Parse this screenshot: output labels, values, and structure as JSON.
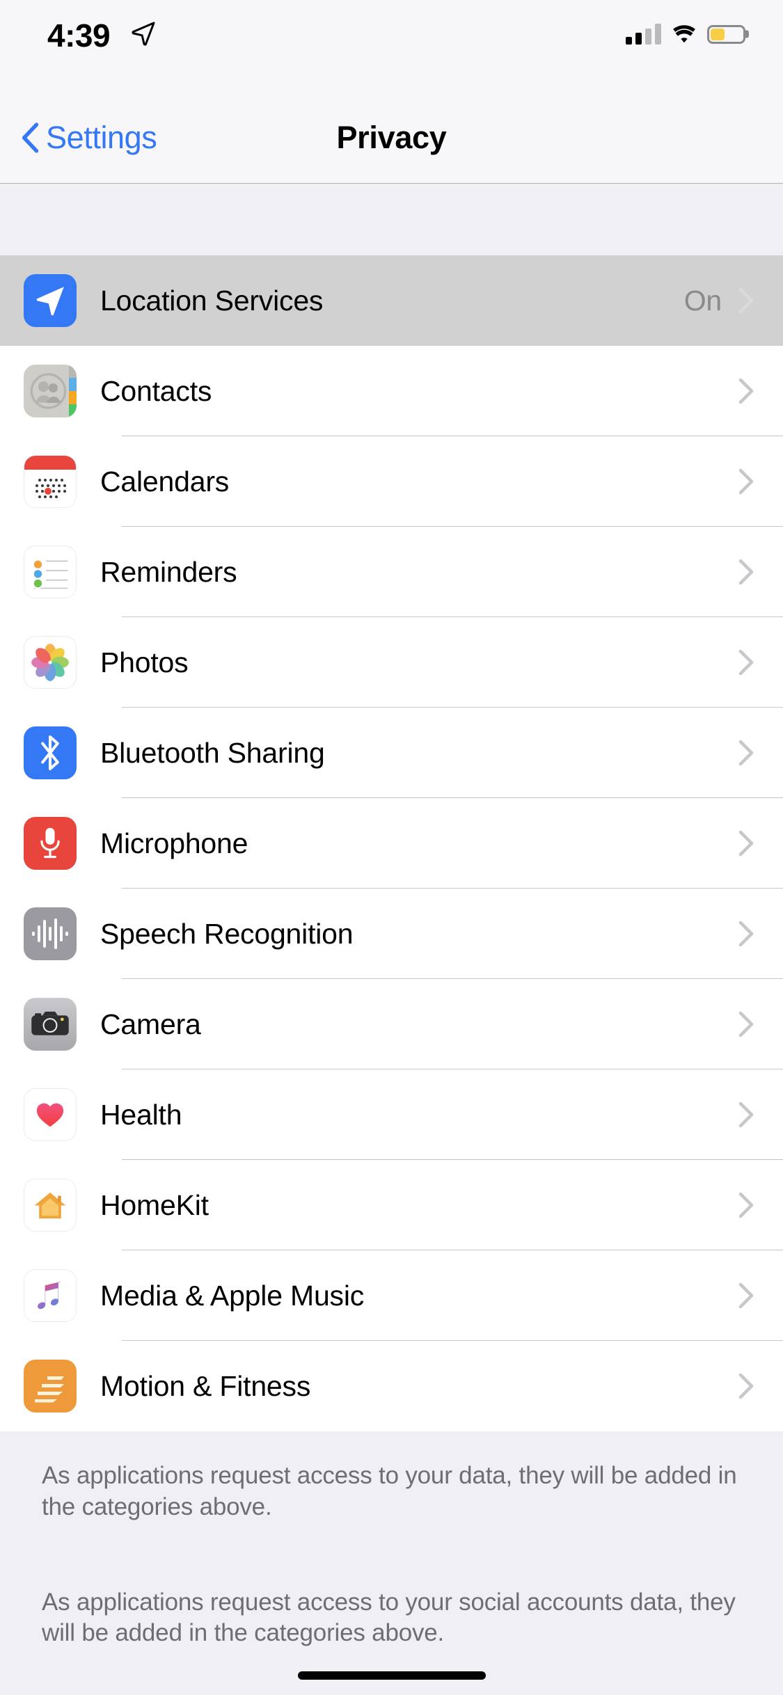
{
  "status_bar": {
    "time": "4:39",
    "location_icon": "location-arrow-icon",
    "cellular_icon": "cellular-signal-icon",
    "cellular_bars_filled": 2,
    "cellular_bars_total": 4,
    "wifi_icon": "wifi-icon",
    "battery_icon": "battery-icon",
    "battery_level_percent": 45,
    "battery_color": "#F7CE46"
  },
  "nav_bar": {
    "back_label": "Settings",
    "back_icon": "chevron-left-icon",
    "title": "Privacy",
    "tint_color": "#3478F6"
  },
  "list": {
    "rows": [
      {
        "label": "Location Services",
        "value": "On",
        "icon": "location-services-icon",
        "selected": true
      },
      {
        "label": "Contacts",
        "value": "",
        "icon": "contacts-icon",
        "selected": false
      },
      {
        "label": "Calendars",
        "value": "",
        "icon": "calendars-icon",
        "selected": false
      },
      {
        "label": "Reminders",
        "value": "",
        "icon": "reminders-icon",
        "selected": false
      },
      {
        "label": "Photos",
        "value": "",
        "icon": "photos-icon",
        "selected": false
      },
      {
        "label": "Bluetooth Sharing",
        "value": "",
        "icon": "bluetooth-icon",
        "selected": false
      },
      {
        "label": "Microphone",
        "value": "",
        "icon": "microphone-icon",
        "selected": false
      },
      {
        "label": "Speech Recognition",
        "value": "",
        "icon": "speech-recognition-icon",
        "selected": false
      },
      {
        "label": "Camera",
        "value": "",
        "icon": "camera-icon",
        "selected": false
      },
      {
        "label": "Health",
        "value": "",
        "icon": "health-icon",
        "selected": false
      },
      {
        "label": "HomeKit",
        "value": "",
        "icon": "homekit-icon",
        "selected": false
      },
      {
        "label": "Media & Apple Music",
        "value": "",
        "icon": "media-apple-music-icon",
        "selected": false
      },
      {
        "label": "Motion & Fitness",
        "value": "",
        "icon": "motion-fitness-icon",
        "selected": false
      }
    ],
    "chevron_icon": "chevron-right-icon",
    "selected_row_background": "#D1D1D1",
    "separator_color": "#C8C7CC"
  },
  "footer": {
    "paragraph_1": "As applications request access to your data, they will be added in the categories above.",
    "paragraph_2": "As applications request access to your social accounts data, they will be added in the categories above."
  },
  "home_indicator": {
    "name": "home-indicator"
  }
}
